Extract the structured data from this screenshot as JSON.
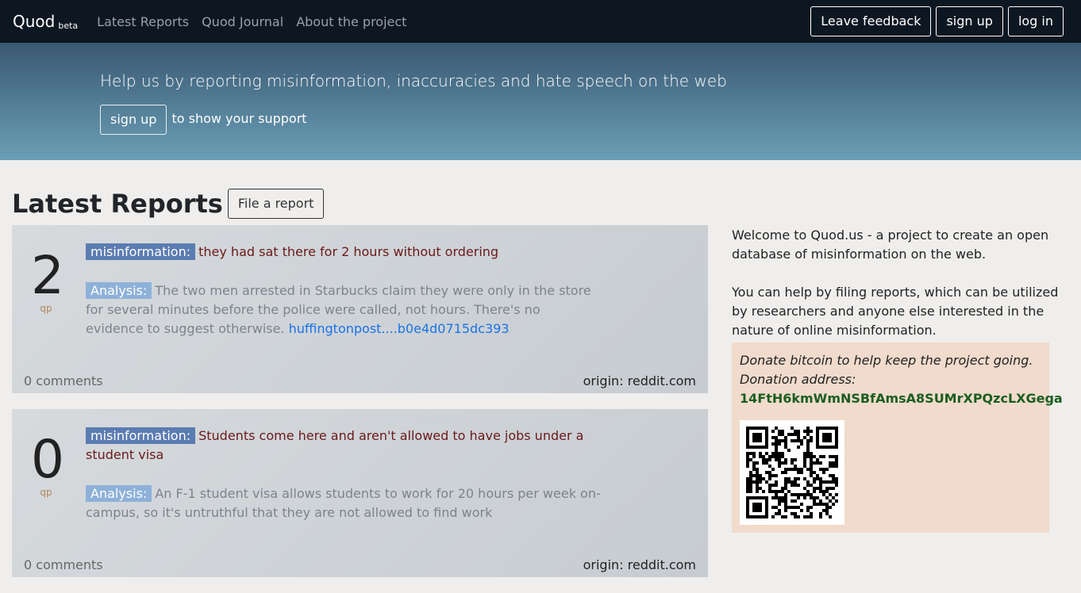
{
  "nav": {
    "brand": "Quod",
    "brand_sup": "beta",
    "links": [
      "Latest Reports",
      "Quod Journal",
      "About the project"
    ],
    "buttons": [
      "Leave feedback",
      "sign up",
      "log in"
    ]
  },
  "hero": {
    "tagline": "Help us by reporting misinformation, inaccuracies and hate speech on the web",
    "signup": "sign up",
    "support": "to show your support"
  },
  "main": {
    "title": "Latest Reports",
    "file_report": "File a report",
    "reports": [
      {
        "score": "2",
        "unit": "qp",
        "label": "misinformation:",
        "claim": "they had sat there for 2 hours without ordering",
        "analysis_label": "Analysis:",
        "analysis": "The two men arrested in Starbucks claim they were only in the store for several minutes before the police were called, not hours. There's no evidence to suggest otherwise.",
        "link": "huffingtonpost....b0e4d0715dc393",
        "comments": "0 comments",
        "origin": "origin: reddit.com"
      },
      {
        "score": "0",
        "unit": "qp",
        "label": "misinformation:",
        "claim": "Students come here and aren't allowed to have jobs under a student visa",
        "analysis_label": "Analysis:",
        "analysis": "An F-1 student visa allows students to work for 20 hours per week on-campus, so it's untruthful that they are not allowed to find work",
        "link": "",
        "comments": "0 comments",
        "origin": "origin: reddit.com"
      }
    ]
  },
  "sidebar": {
    "welcome": "Welcome to Quod.us - a project to create an open database of misinformation on the web.",
    "help": "You can help by filing reports, which can be utilized by researchers and anyone else interested in the nature of online misinformation.",
    "donate_line1": "Donate bitcoin to help keep the project going.",
    "donate_line2": "Donation address:",
    "address": "14FtH6kmWmNSBfAmsA8SUMrXPQzcLXGega"
  }
}
